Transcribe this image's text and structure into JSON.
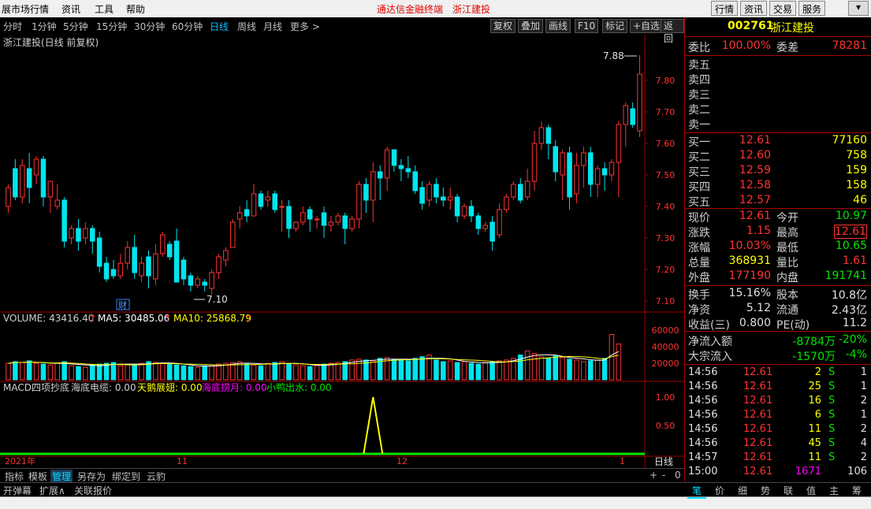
{
  "menubar": {
    "items": [
      "展市场行情",
      "资讯",
      "工具",
      "帮助"
    ],
    "center_app": "通达信金融终端",
    "center_stock": "浙江建投",
    "right_buttons": [
      "行情",
      "资讯",
      "交易",
      "服务"
    ]
  },
  "periods": {
    "items": [
      "分时",
      "1分钟",
      "5分钟",
      "15分钟",
      "30分钟",
      "60分钟",
      "日线",
      "周线",
      "月线",
      "更多 >"
    ],
    "active": "日线"
  },
  "toolbar": [
    "复权",
    "叠加",
    "画线",
    "F10",
    "标记",
    "+自选",
    "返回"
  ],
  "chart": {
    "title": "浙江建投(日线 前复权)",
    "price_ticks": [
      "7.80",
      "7.70",
      "7.60",
      "7.50",
      "7.40",
      "7.30",
      "7.20",
      "7.10"
    ],
    "high_label": "7.88",
    "low_label": "7.10",
    "cai_marker": "财",
    "volume_label": "VOLUME: 43416.40",
    "ma5_label": "MA5: 30485.06",
    "ma10_label": "MA10: 25868.79",
    "volume_ticks": [
      "60000",
      "40000",
      "20000"
    ],
    "macd_label": "MACD四项抄底",
    "ind1": "海底电缆: 0.00",
    "ind2": "天鹅展翅: 0.00",
    "ind3": "海底捞月: 0.00",
    "ind4": "小鸭出水: 0.00",
    "macd_ticks": [
      "1.00",
      "0.50"
    ],
    "date_labels": [
      "2021年",
      "11",
      "12",
      "1"
    ],
    "period_label": "日线",
    "zoom_buttons": [
      "+",
      "-",
      "0"
    ],
    "colors": {
      "up": "#ff3232",
      "down": "#00e5ee",
      "ma5": "#ffffff",
      "ma10": "#ffff00",
      "grid": "#a00000"
    }
  },
  "bottom_tabs": [
    "指标",
    "模板",
    "管理",
    "另存为",
    "绑定到",
    "云豹"
  ],
  "bottom_tabs_selected": "管理",
  "bottom_tabs2": [
    "开弹幕",
    "扩展∧",
    "关联报价"
  ],
  "quote": {
    "code": "002761",
    "name": "浙江建投",
    "weibi_label": "委比",
    "weibi": "100.00%",
    "weicha_label": "委差",
    "weicha": "78281",
    "sell": [
      {
        "label": "卖五"
      },
      {
        "label": "卖四"
      },
      {
        "label": "卖三"
      },
      {
        "label": "卖二"
      },
      {
        "label": "卖一"
      }
    ],
    "buy": [
      {
        "label": "买一",
        "price": "12.61",
        "vol": "77160"
      },
      {
        "label": "买二",
        "price": "12.60",
        "vol": "758"
      },
      {
        "label": "买三",
        "price": "12.59",
        "vol": "159"
      },
      {
        "label": "买四",
        "price": "12.58",
        "vol": "158"
      },
      {
        "label": "买五",
        "price": "12.57",
        "vol": "46"
      }
    ],
    "stats": [
      {
        "l1": "现价",
        "v1": "12.61",
        "c1": "red",
        "l2": "今开",
        "v2": "10.97",
        "c2": "green"
      },
      {
        "l1": "涨跌",
        "v1": "1.15",
        "c1": "red",
        "l2": "最高",
        "v2": "12.61",
        "c2": "red"
      },
      {
        "l1": "涨幅",
        "v1": "10.03%",
        "c1": "red",
        "l2": "最低",
        "v2": "10.65",
        "c2": "green"
      },
      {
        "l1": "总量",
        "v1": "368931",
        "c1": "yellow",
        "l2": "量比",
        "v2": "1.61",
        "c2": "red"
      },
      {
        "l1": "外盘",
        "v1": "177190",
        "c1": "red",
        "l2": "内盘",
        "v2": "191741",
        "c2": "green"
      }
    ],
    "stats2": [
      {
        "l1": "换手",
        "v1": "15.16%",
        "l2": "股本",
        "v2": "10.8亿"
      },
      {
        "l1": "净资",
        "v1": "5.12",
        "l2": "流通",
        "v2": "2.43亿"
      },
      {
        "l1": "收益(三)",
        "v1": "0.800",
        "l2": "PE(动)",
        "v2": "11.2"
      }
    ],
    "flow": [
      {
        "label": "净流入额",
        "v": "-8784万",
        "p": "-20%"
      },
      {
        "label": "大宗流入",
        "v": "-1570万",
        "p": "-4%"
      }
    ],
    "ticks": [
      {
        "t": "14:56",
        "p": "12.61",
        "v": "2",
        "d": "S",
        "n": "1",
        "vc": "yellow"
      },
      {
        "t": "14:56",
        "p": "12.61",
        "v": "25",
        "d": "S",
        "n": "1",
        "vc": "yellow"
      },
      {
        "t": "14:56",
        "p": "12.61",
        "v": "16",
        "d": "S",
        "n": "2",
        "vc": "yellow"
      },
      {
        "t": "14:56",
        "p": "12.61",
        "v": "6",
        "d": "S",
        "n": "1",
        "vc": "yellow"
      },
      {
        "t": "14:56",
        "p": "12.61",
        "v": "11",
        "d": "S",
        "n": "2",
        "vc": "yellow"
      },
      {
        "t": "14:56",
        "p": "12.61",
        "v": "45",
        "d": "S",
        "n": "4",
        "vc": "yellow"
      },
      {
        "t": "14:57",
        "p": "12.61",
        "v": "11",
        "d": "S",
        "n": "2",
        "vc": "yellow"
      },
      {
        "t": "15:00",
        "p": "12.61",
        "v": "1671",
        "d": "",
        "n": "106",
        "vc": "magenta"
      }
    ],
    "tabs": [
      "笔",
      "价",
      "细",
      "势",
      "联",
      "值",
      "主",
      "筹"
    ],
    "tab_selected": "笔"
  },
  "chart_data": {
    "type": "candlestick",
    "ylim": [
      7.07,
      7.9
    ],
    "candles": [
      [
        7.4,
        7.46,
        7.47,
        7.38
      ],
      [
        7.52,
        7.43,
        7.55,
        7.42
      ],
      [
        7.43,
        7.53,
        7.55,
        7.41
      ],
      [
        7.52,
        7.46,
        7.57,
        7.41
      ],
      [
        7.5,
        7.55,
        7.56,
        7.47
      ],
      [
        7.55,
        7.43,
        7.56,
        7.4
      ],
      [
        7.43,
        7.48,
        7.48,
        7.38
      ],
      [
        7.4,
        7.42,
        7.47,
        7.39
      ],
      [
        7.42,
        7.29,
        7.43,
        7.27
      ],
      [
        7.3,
        7.33,
        7.34,
        7.28
      ],
      [
        7.33,
        7.29,
        7.36,
        7.26
      ],
      [
        7.3,
        7.33,
        7.35,
        7.28
      ],
      [
        7.33,
        7.29,
        7.34,
        7.25
      ],
      [
        7.3,
        7.21,
        7.32,
        7.19
      ],
      [
        7.22,
        7.17,
        7.24,
        7.16
      ],
      [
        7.2,
        7.18,
        7.23,
        7.17
      ],
      [
        7.18,
        7.22,
        7.25,
        7.17
      ],
      [
        7.22,
        7.27,
        7.29,
        7.2
      ],
      [
        7.27,
        7.19,
        7.31,
        7.17
      ],
      [
        7.18,
        7.22,
        7.24,
        7.16
      ],
      [
        7.24,
        7.18,
        7.26,
        7.14
      ],
      [
        7.17,
        7.25,
        7.28,
        7.15
      ],
      [
        7.25,
        7.31,
        7.32,
        7.24
      ],
      [
        7.28,
        7.24,
        7.29,
        7.23
      ],
      [
        7.29,
        7.16,
        7.33,
        7.16
      ],
      [
        7.23,
        7.17,
        7.24,
        7.15
      ],
      [
        7.18,
        7.15,
        7.19,
        7.13
      ],
      [
        7.15,
        7.17,
        7.18,
        7.14
      ],
      [
        7.16,
        7.15,
        7.17,
        7.13
      ],
      [
        7.14,
        7.19,
        7.2,
        7.12
      ],
      [
        7.19,
        7.24,
        7.25,
        7.17
      ],
      [
        7.23,
        7.26,
        7.27,
        7.21
      ],
      [
        7.27,
        7.35,
        7.36,
        7.27
      ],
      [
        7.36,
        7.38,
        7.4,
        7.33
      ],
      [
        7.39,
        7.37,
        7.42,
        7.35
      ],
      [
        7.37,
        7.44,
        7.47,
        7.37
      ],
      [
        7.44,
        7.4,
        7.45,
        7.39
      ],
      [
        7.42,
        7.43,
        7.45,
        7.4
      ],
      [
        7.44,
        7.39,
        7.45,
        7.38
      ],
      [
        7.4,
        7.4,
        7.42,
        7.32
      ],
      [
        7.4,
        7.33,
        7.42,
        7.3
      ],
      [
        7.33,
        7.35,
        7.35,
        7.32
      ],
      [
        7.35,
        7.38,
        7.4,
        7.34
      ],
      [
        7.39,
        7.36,
        7.4,
        7.32
      ],
      [
        7.36,
        7.36,
        7.37,
        7.33
      ],
      [
        7.38,
        7.34,
        7.4,
        7.3
      ],
      [
        7.34,
        7.35,
        7.37,
        7.32
      ],
      [
        7.35,
        7.37,
        7.38,
        7.34
      ],
      [
        7.37,
        7.33,
        7.38,
        7.28
      ],
      [
        7.33,
        7.36,
        7.37,
        7.32
      ],
      [
        7.36,
        7.47,
        7.48,
        7.33
      ],
      [
        7.47,
        7.42,
        7.49,
        7.38
      ],
      [
        7.42,
        7.51,
        7.54,
        7.35
      ],
      [
        7.51,
        7.49,
        7.53,
        7.42
      ],
      [
        7.49,
        7.58,
        7.59,
        7.45
      ],
      [
        7.58,
        7.53,
        7.58,
        7.51
      ],
      [
        7.53,
        7.52,
        7.55,
        7.48
      ],
      [
        7.52,
        7.51,
        7.56,
        7.49
      ],
      [
        7.51,
        7.45,
        7.53,
        7.44
      ],
      [
        7.46,
        7.41,
        7.48,
        7.39
      ],
      [
        7.42,
        7.47,
        7.48,
        7.4
      ],
      [
        7.47,
        7.43,
        7.49,
        7.41
      ],
      [
        7.43,
        7.42,
        7.46,
        7.4
      ],
      [
        7.42,
        7.43,
        7.46,
        7.39
      ],
      [
        7.43,
        7.37,
        7.44,
        7.35
      ],
      [
        7.37,
        7.4,
        7.41,
        7.36
      ],
      [
        7.4,
        7.37,
        7.42,
        7.35
      ],
      [
        7.37,
        7.33,
        7.38,
        7.31
      ],
      [
        7.33,
        7.34,
        7.35,
        7.32
      ],
      [
        7.35,
        7.29,
        7.37,
        7.26
      ],
      [
        7.31,
        7.39,
        7.41,
        7.3
      ],
      [
        7.39,
        7.43,
        7.44,
        7.38
      ],
      [
        7.43,
        7.47,
        7.48,
        7.42
      ],
      [
        7.47,
        7.42,
        7.49,
        7.41
      ],
      [
        7.43,
        7.48,
        7.52,
        7.42
      ],
      [
        7.48,
        7.6,
        7.64,
        7.45
      ],
      [
        7.6,
        7.65,
        7.67,
        7.58
      ],
      [
        7.65,
        7.6,
        7.66,
        7.55
      ],
      [
        7.59,
        7.51,
        7.61,
        7.48
      ],
      [
        7.5,
        7.57,
        7.58,
        7.42
      ],
      [
        7.57,
        7.43,
        7.59,
        7.39
      ],
      [
        7.44,
        7.53,
        7.57,
        7.41
      ],
      [
        7.53,
        7.57,
        7.59,
        7.46
      ],
      [
        7.57,
        7.47,
        7.59,
        7.43
      ],
      [
        7.47,
        7.52,
        7.53,
        7.43
      ],
      [
        7.52,
        7.5,
        7.54,
        7.45
      ],
      [
        7.5,
        7.54,
        7.55,
        7.48
      ],
      [
        7.54,
        7.66,
        7.67,
        7.43
      ],
      [
        7.66,
        7.72,
        7.73,
        7.59
      ],
      [
        7.71,
        7.66,
        7.73,
        7.65
      ],
      [
        7.64,
        7.82,
        7.88,
        7.62
      ]
    ],
    "volumes": [
      20000,
      22000,
      21000,
      23000,
      20000,
      19000,
      18000,
      20000,
      22000,
      17000,
      16000,
      15000,
      18000,
      19000,
      20000,
      21000,
      17000,
      18000,
      19000,
      20000,
      22000,
      21000,
      20000,
      19000,
      18000,
      17000,
      16000,
      15000,
      17000,
      18000,
      19000,
      20000,
      21000,
      22000,
      19000,
      18000,
      17000,
      20000,
      21000,
      22000,
      19000,
      18000,
      17000,
      16000,
      18000,
      19000,
      20000,
      21000,
      22000,
      24000,
      25000,
      24000,
      23000,
      26000,
      27000,
      25000,
      24000,
      23000,
      26000,
      28000,
      30000,
      24000,
      22000,
      23000,
      21000,
      22000,
      20000,
      19000,
      21000,
      22000,
      23000,
      24000,
      26000,
      30000,
      35000,
      32000,
      28000,
      26000,
      29000,
      27000,
      25000,
      24000,
      22000,
      23000,
      24000,
      26000,
      55000,
      43416
    ],
    "vol_ylim": [
      0,
      65000
    ]
  }
}
